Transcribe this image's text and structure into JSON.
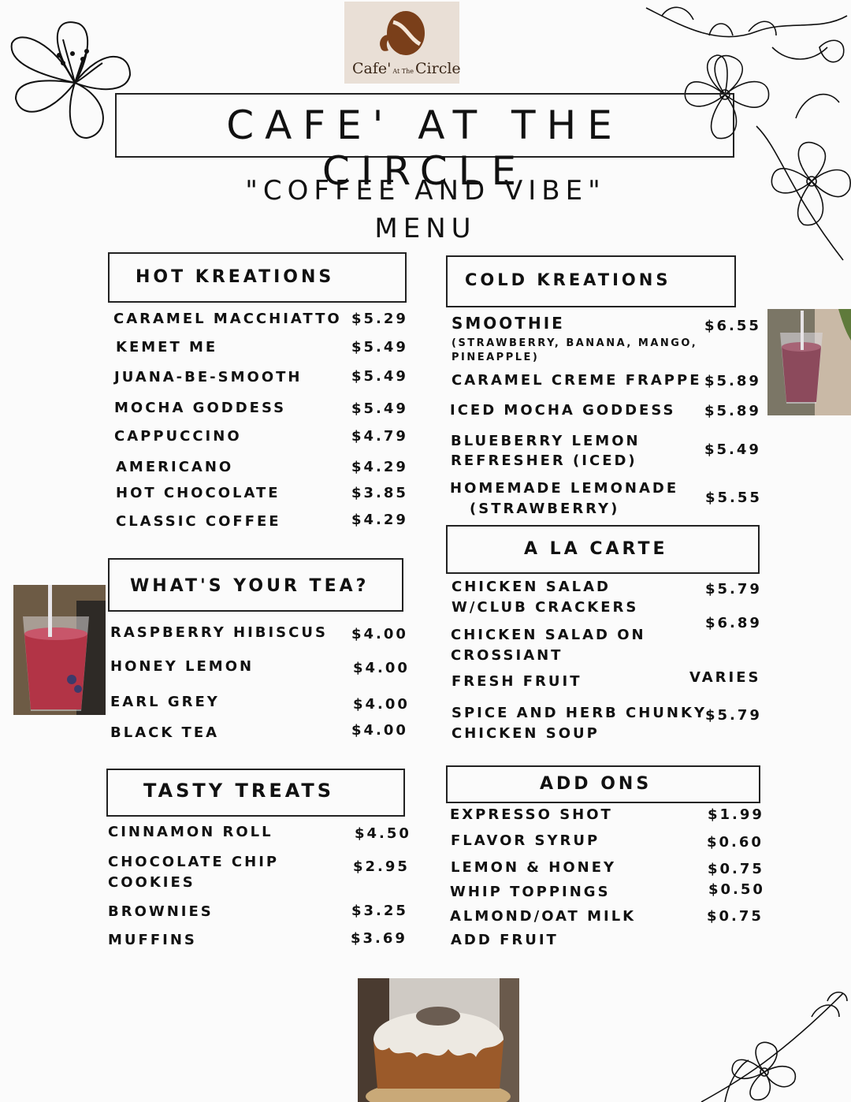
{
  "logo": {
    "text_main": "Cafe'",
    "text_small": "At The",
    "text_end": "Circle",
    "bg_color": "#e9dfd6",
    "bean_color": "#7a3f1a"
  },
  "header": {
    "title": "CAFE' AT THE CIRCLE",
    "tagline": "\"COFFEE AND VIBE\"",
    "menu_word": "MENU"
  },
  "hot": {
    "title": "HOT KREATIONS",
    "items": [
      {
        "name": "CARAMEL MACCHIATTO",
        "price": "$5.29"
      },
      {
        "name": "KEMET ME",
        "price": "$5.49"
      },
      {
        "name": "JUANA-BE-SMOOTH",
        "price": "$5.49"
      },
      {
        "name": "MOCHA GODDESS",
        "price": "$5.49"
      },
      {
        "name": "CAPPUCCINO",
        "price": "$4.79"
      },
      {
        "name": "AMERICANO",
        "price": "$4.29"
      },
      {
        "name": "HOT CHOCOLATE",
        "price": "$3.85"
      },
      {
        "name": "CLASSIC COFFEE",
        "price": "$4.29"
      }
    ]
  },
  "cold": {
    "title": "COLD KREATIONS",
    "items": [
      {
        "name": "SMOOTHIE",
        "sub1": "(STRAWBERRY, BANANA, MANGO,",
        "sub2": "PINEAPPLE)",
        "price": "$6.55"
      },
      {
        "name": "CARAMEL CREME FRAPPE",
        "price": "$5.89"
      },
      {
        "name": "ICED MOCHA GODDESS",
        "price": "$5.89"
      },
      {
        "name": "BLUEBERRY LEMON",
        "name2": "REFRESHER (ICED)",
        "price": "$5.49"
      },
      {
        "name": "HOMEMADE LEMONADE",
        "name2": "(STRAWBERRY)",
        "price": "$5.55"
      }
    ]
  },
  "tea": {
    "title": "WHAT'S YOUR TEA?",
    "items": [
      {
        "name": "RASPBERRY HIBISCUS",
        "price": "$4.00"
      },
      {
        "name": "HONEY LEMON",
        "price": "$4.00"
      },
      {
        "name": "EARL GREY",
        "price": "$4.00"
      },
      {
        "name": "BLACK TEA",
        "price": "$4.00"
      }
    ]
  },
  "carte": {
    "title": "A LA CARTE",
    "items": [
      {
        "name": "CHICKEN SALAD",
        "name2": "W/CLUB CRACKERS",
        "price": "$5.79"
      },
      {
        "name": "CHICKEN SALAD ON",
        "name2": "CROSSIANT",
        "price": "$6.89"
      },
      {
        "name": "FRESH FRUIT",
        "price": "VARIES"
      },
      {
        "name": "SPICE AND HERB CHUNKY",
        "name2": "CHICKEN SOUP",
        "price": "$5.79"
      }
    ]
  },
  "treats": {
    "title": "TASTY TREATS",
    "items": [
      {
        "name": "CINNAMON ROLL",
        "price": "$4.50"
      },
      {
        "name": "CHOCOLATE CHIP",
        "name2": "COOKIES",
        "price": "$2.95"
      },
      {
        "name": "BROWNIES",
        "price": "$3.25"
      },
      {
        "name": "MUFFINS",
        "price": "$3.69"
      }
    ]
  },
  "addons": {
    "title": "ADD ONS",
    "items": [
      {
        "name": "EXPRESSO SHOT",
        "price": "$1.99"
      },
      {
        "name": "FLAVOR SYRUP",
        "price": "$0.60"
      },
      {
        "name": "LEMON & HONEY",
        "price": "$0.75"
      },
      {
        "name": "WHIP TOPPINGS",
        "price": "$0.50"
      },
      {
        "name": "ALMOND/OAT MILK",
        "price": "$0.75"
      },
      {
        "name": "ADD FRUIT",
        "price": ""
      }
    ]
  },
  "icons": [
    "flower-top-left-icon",
    "flower-top-right-icon",
    "flower-bottom-right-icon",
    "coffee-bean-logo-icon"
  ]
}
